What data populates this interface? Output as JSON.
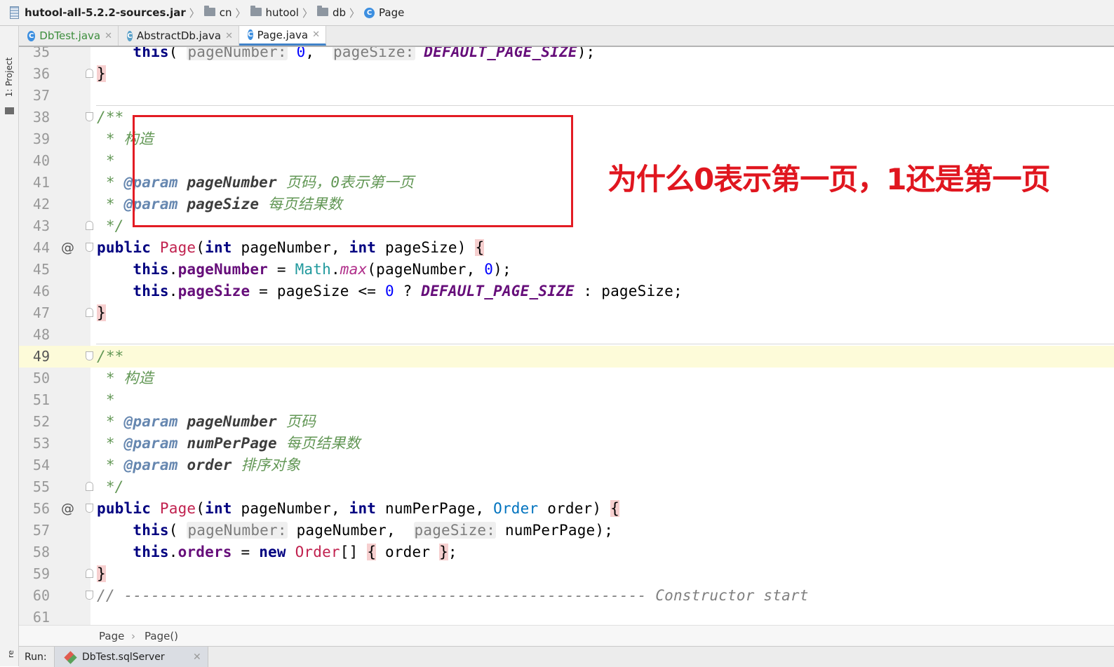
{
  "navbar": {
    "jar": "hutool-all-5.2.2-sources.jar",
    "crumbs": [
      "cn",
      "hutool",
      "db"
    ],
    "current": "Page"
  },
  "left_strip": {
    "project_tab": "1: Project"
  },
  "tabs": [
    {
      "label": "DbTest.java",
      "active": false
    },
    {
      "label": "AbstractDb.java",
      "active": false
    },
    {
      "label": "Page.java",
      "active": true
    }
  ],
  "code": {
    "line_numbers": [
      "35",
      "36",
      "37",
      "38",
      "39",
      "40",
      "41",
      "42",
      "43",
      "44",
      "45",
      "46",
      "47",
      "48",
      "49",
      "50",
      "51",
      "52",
      "53",
      "54",
      "55",
      "56",
      "57",
      "58",
      "59",
      "60",
      "61"
    ],
    "current_line": "49",
    "hints": {
      "page_number": "pageNumber:",
      "page_size": "pageSize:"
    },
    "keywords": {
      "this": "this",
      "public": "public",
      "int": "int",
      "new": "new"
    },
    "tokens": {
      "zero": "0",
      "default_page_size": "DEFAULT_PAGE_SIZE",
      "close_brace": "}",
      "open_brace": "{",
      "doc_open": "/**",
      "doc_star": "*",
      "doc_close": "*/",
      "ctor_desc": "构造",
      "param_tag": "@param",
      "p_page_number": "pageNumber",
      "p_page_size": "pageSize",
      "p_num_per_page": "numPerPage",
      "p_order": "order",
      "desc_page_number_1": "页码，0表示第一页",
      "desc_page_size": "每页结果数",
      "desc_page_number_2": "页码",
      "desc_num_per_page": "每页结果数",
      "desc_order": "排序对象",
      "ctor_name": "Page",
      "math": "Math",
      "max": "max",
      "field_page_number": "pageNumber",
      "field_page_size": "pageSize",
      "field_orders": "orders",
      "order_class": "Order",
      "var_page_number": "pageNumber",
      "var_page_size": "pageSize",
      "var_num_per_page": "numPerPage",
      "var_order": "order",
      "comment_line": "// ---------------------------------------------------------- Constructor start"
    }
  },
  "annotation": {
    "text": "为什么0表示第一页，1还是第一页",
    "color": "#e0161f"
  },
  "breadcrumb": {
    "items": [
      "Page",
      "Page()"
    ]
  },
  "run": {
    "label": "Run:",
    "config": "DbTest.sqlServer"
  },
  "left_bottom_label": "re"
}
